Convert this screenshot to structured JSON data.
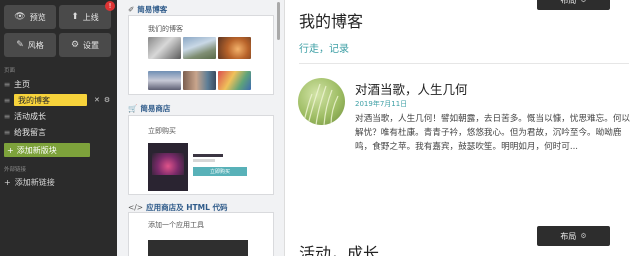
{
  "toolbar": {
    "preview": "预览",
    "publish": "上线",
    "publish_badge": "!",
    "style": "风格",
    "settings": "设置"
  },
  "sidebar": {
    "pages_section": "页面",
    "pages": [
      {
        "label": "主页"
      },
      {
        "label": "我的博客"
      },
      {
        "label": "活动成长"
      },
      {
        "label": "给我留言"
      }
    ],
    "add_block": "添加新版块",
    "links_section": "外部链接",
    "add_link": "添加新链接"
  },
  "panel": {
    "cat1": "简易博客",
    "card1_title": "我们的博客",
    "card1_captions": [
      "",
      "",
      "",
      "",
      "",
      ""
    ],
    "cat2": "简易商店",
    "card2_title": "立即购买",
    "card2_sub": "",
    "card2_product": "",
    "card2_buy": "立即购买",
    "cat3": "应用商店及 HTML 代码",
    "card3_title": "添加一个应用工具",
    "card3_sub": ""
  },
  "preview": {
    "layout_label": "布局",
    "title": "我的博客",
    "subtitle": "行走，记录",
    "post": {
      "title": "对酒当歌，人生几何",
      "date": "2019年7月11日",
      "body": "对酒当歌，人生几何！譬如朝露，去日苦多。慨当以慷，忧思难忘。何以解忧？唯有杜康。青青子衿，悠悠我心。但为君故，沉吟至今。呦呦鹿鸣，食野之苹。我有嘉宾，鼓瑟吹笙。明明如月，何时可..."
    },
    "section2_title": "活动，成长"
  }
}
